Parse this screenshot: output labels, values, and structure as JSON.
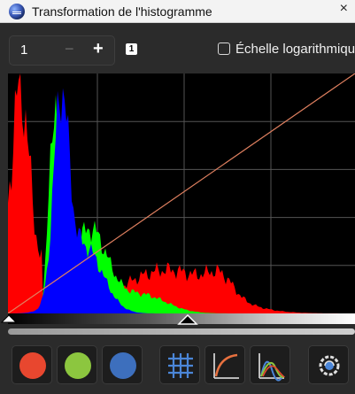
{
  "window": {
    "title": "Transformation de l'histogramme",
    "close_icon": "×"
  },
  "toolbar": {
    "stepper_value": "1",
    "minus_label": "−",
    "plus_label": "+",
    "channel_badge": "1",
    "log_scale_label": "Échelle logarithmique",
    "log_scale_checked": false
  },
  "channel_buttons": [
    {
      "name": "red-channel",
      "color": "#e8472f"
    },
    {
      "name": "green-channel",
      "color": "#8cc63f"
    },
    {
      "name": "blue-channel",
      "color": "#3d6fbd"
    }
  ],
  "tool_buttons": [
    {
      "name": "grid-icon"
    },
    {
      "name": "curve-icon"
    },
    {
      "name": "histogram-curves-icon"
    },
    {
      "name": "settings-gear-icon"
    }
  ],
  "histogram": {
    "colors": {
      "red": "#ff0000",
      "green": "#00ff00",
      "blue": "#0000ff",
      "transfer_curve": "#e08060",
      "grid": "#555555"
    }
  }
}
